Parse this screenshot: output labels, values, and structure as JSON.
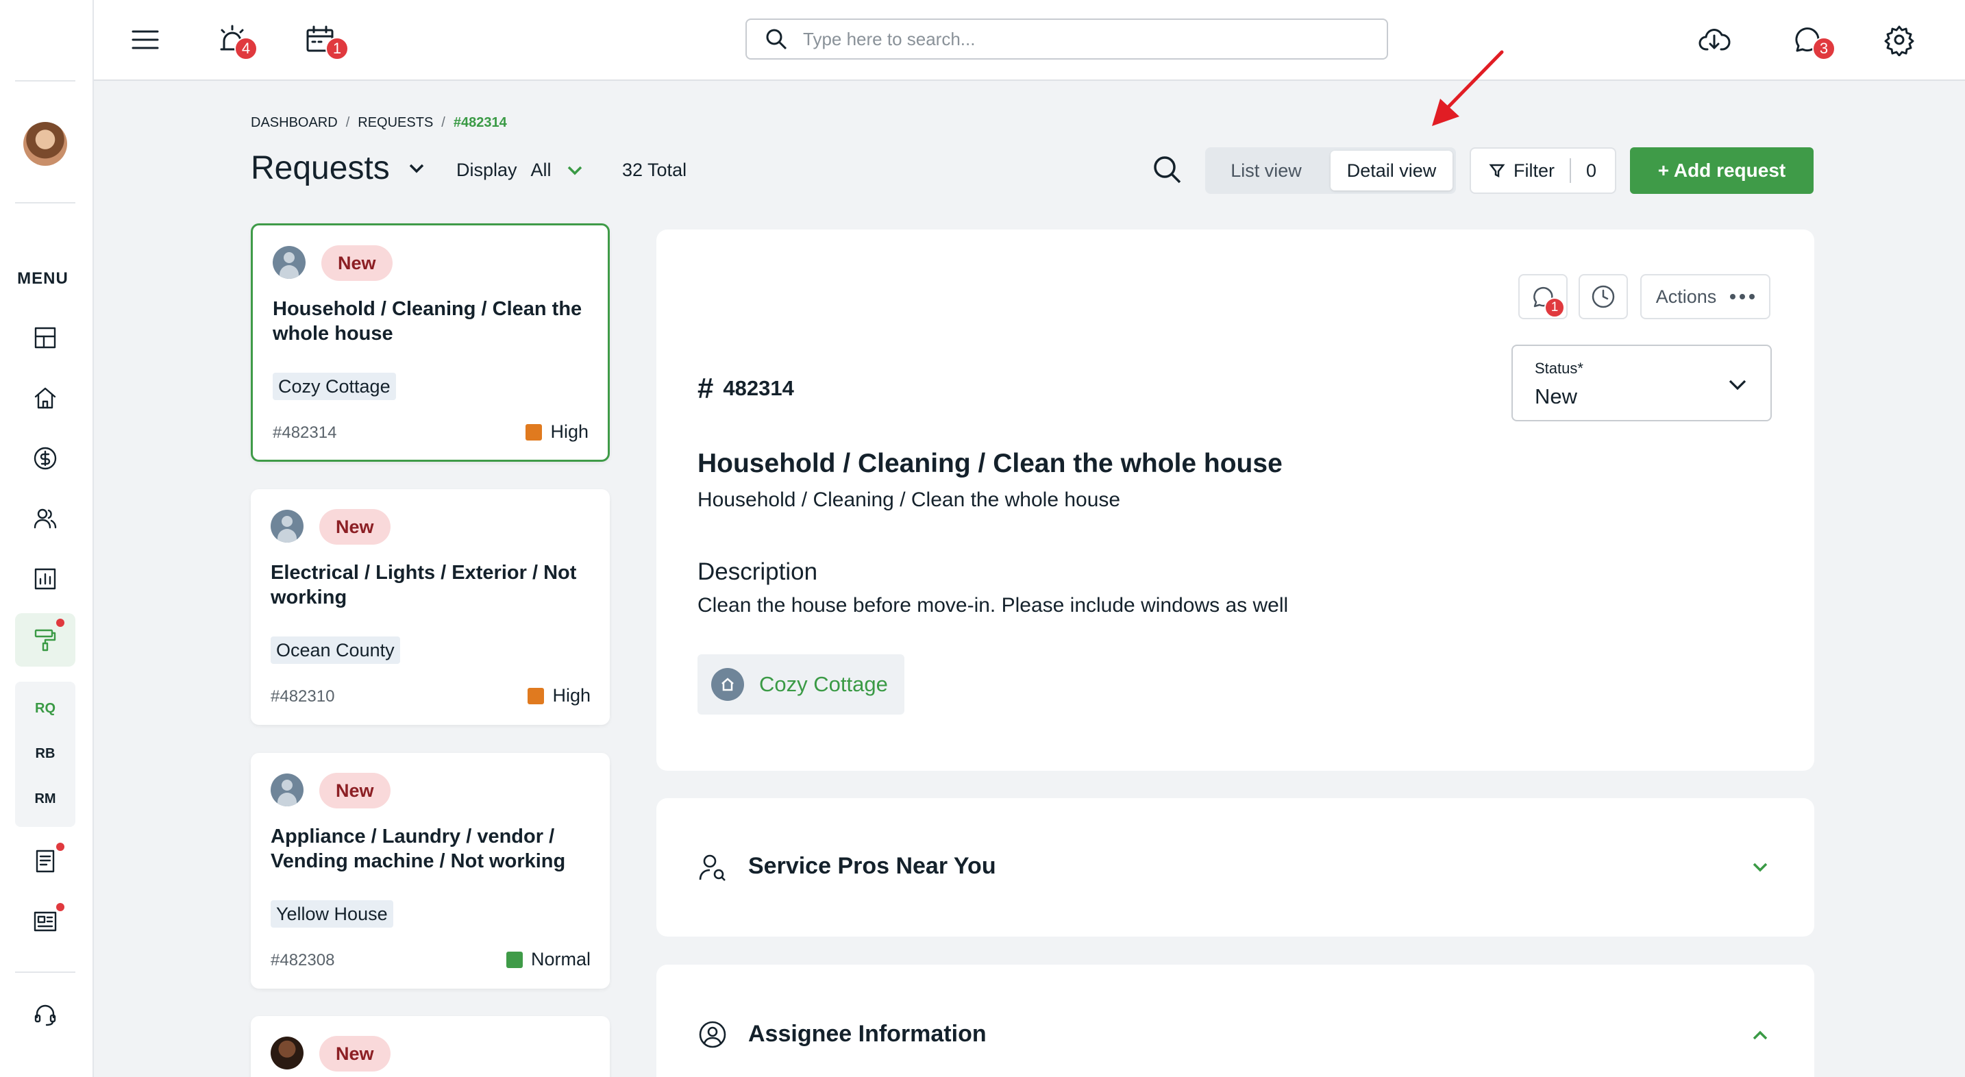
{
  "topbar": {
    "alarm_badge": "4",
    "calendar_badge": "1",
    "chat_badge": "3",
    "search_placeholder": "Type here to search..."
  },
  "sidebar": {
    "menu_label": "MENU",
    "sub_items": [
      "RQ",
      "RB",
      "RM"
    ],
    "icons": [
      "dashboard-icon",
      "home-icon",
      "dollar-icon",
      "users-icon",
      "chart-icon",
      "paint-roller-icon",
      "document-icon",
      "newspaper-icon",
      "headset-icon"
    ]
  },
  "breadcrumb": [
    "DASHBOARD",
    "REQUESTS",
    "#482314"
  ],
  "header": {
    "title": "Requests",
    "display_label": "Display",
    "display_value": "All",
    "total": "32 Total",
    "list_view": "List view",
    "detail_view": "Detail view",
    "filter_label": "Filter",
    "filter_count": "0",
    "add_label": "+ Add request"
  },
  "cards": [
    {
      "status": "New",
      "title": "Household / Cleaning / Clean the whole house",
      "property": "Cozy Cottage",
      "id": "#482314",
      "priority": "High",
      "priority_color": "#e07a1f"
    },
    {
      "status": "New",
      "title": "Electrical / Lights / Exterior / Not working",
      "property": "Ocean County",
      "id": "#482310",
      "priority": "High",
      "priority_color": "#e07a1f"
    },
    {
      "status": "New",
      "title": "Appliance / Laundry / vendor / Vending machine / Not working",
      "property": "Yellow House",
      "id": "#482308",
      "priority": "Normal",
      "priority_color": "#3f9b48"
    },
    {
      "status": "New"
    }
  ],
  "detail": {
    "chat_badge": "1",
    "actions_label": "Actions",
    "status_label": "Status*",
    "status_value": "New",
    "id": "482314",
    "title": "Household / Cleaning / Clean the whole house",
    "subtitle": "Household / Cleaning / Clean the whole house",
    "description_heading": "Description",
    "description": "Clean the house before move-in. Please include windows as well",
    "property": "Cozy Cottage"
  },
  "sections": {
    "service_pros": "Service Pros Near You",
    "assignee": "Assignee Information"
  },
  "colors": {
    "accent_green": "#3f9b48",
    "badge_red": "#e0393e",
    "annotation_red": "#e11d24"
  }
}
